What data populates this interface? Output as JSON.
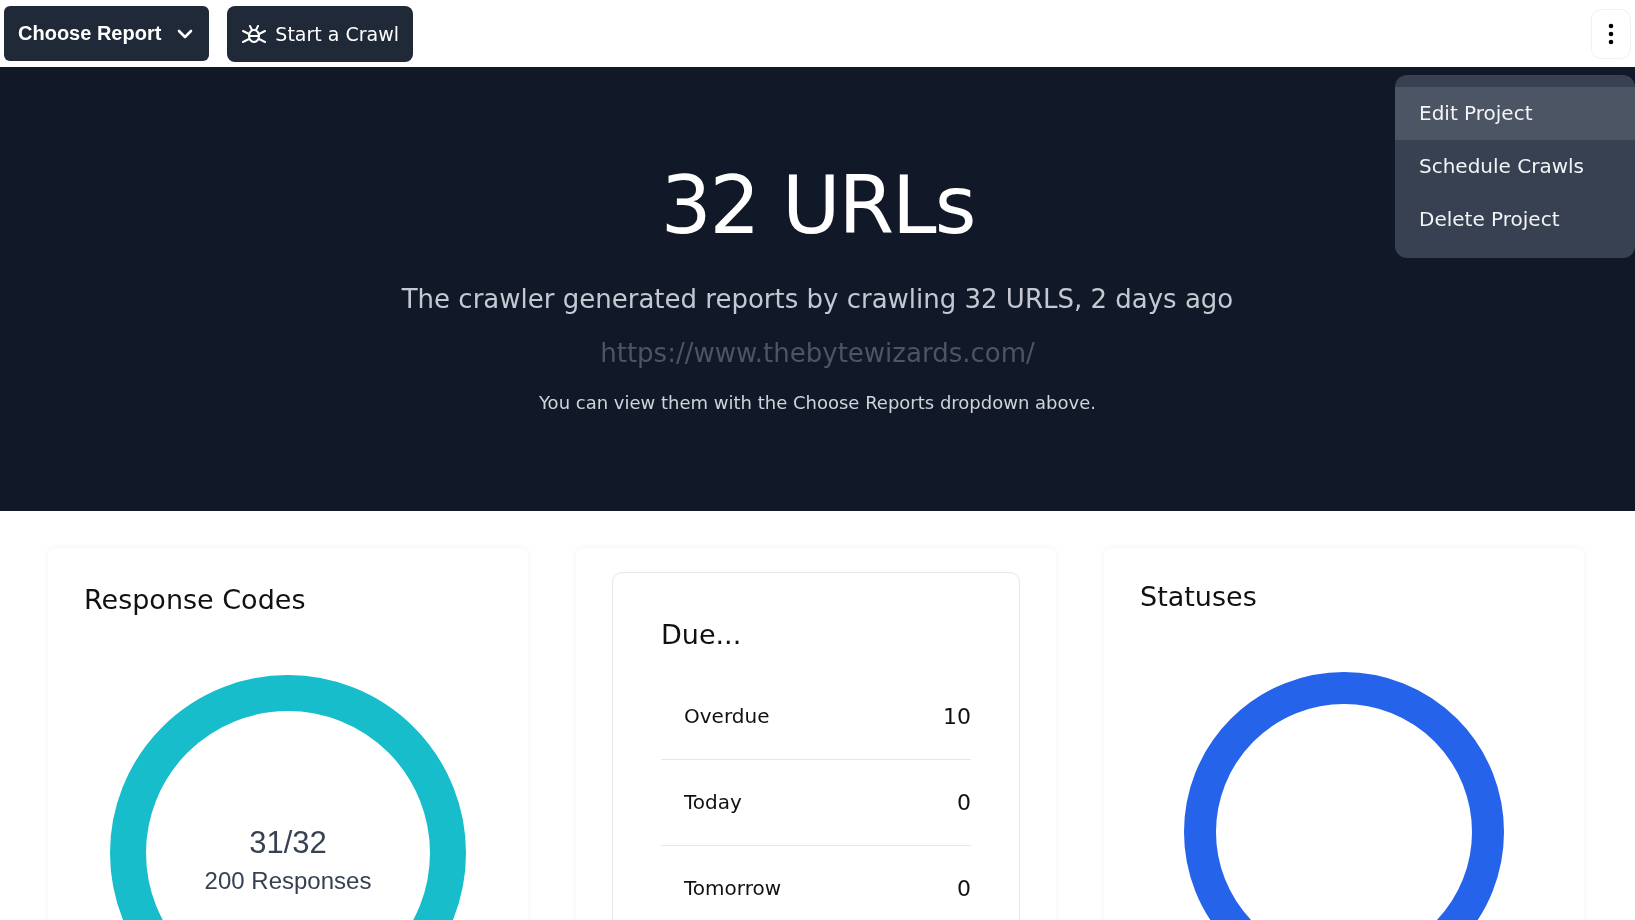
{
  "toolbar": {
    "report_button": "Choose Report",
    "crawl_button": "Start a Crawl"
  },
  "menu": {
    "items": [
      {
        "label": "Edit Project",
        "selected": true
      },
      {
        "label": "Schedule Crawls",
        "selected": false
      },
      {
        "label": "Delete Project",
        "selected": false
      }
    ]
  },
  "hero": {
    "title": "32 URLs",
    "subtitle": "The crawler generated reports by crawling 32 URLS, 2 days ago",
    "url": "https://www.thebytewizards.com/",
    "note": "You can view them with the Choose Reports dropdown above."
  },
  "response_codes": {
    "title": "Response Codes",
    "ratio": "31/32",
    "caption": "200 Responses"
  },
  "due": {
    "title": "Due...",
    "rows": [
      {
        "label": "Overdue",
        "count": "10"
      },
      {
        "label": "Today",
        "count": "0"
      },
      {
        "label": "Tomorrow",
        "count": "0"
      }
    ]
  },
  "statuses": {
    "title": "Statuses"
  }
}
